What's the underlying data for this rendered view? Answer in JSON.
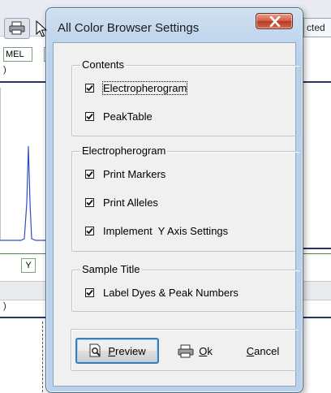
{
  "background": {
    "tab_text": "cted",
    "header_text": "MEL",
    "paren_text": ")",
    "y_label": "Y"
  },
  "dialog": {
    "title": "All Color Browser Settings",
    "groups": [
      {
        "label": "Contents",
        "items": [
          {
            "label": "Electropherogram",
            "checked": true
          },
          {
            "label": "PeakTable",
            "checked": true
          }
        ]
      },
      {
        "label": "Electropherogram",
        "items": [
          {
            "label": "Print Markers",
            "checked": true
          },
          {
            "label": "Print Alleles",
            "checked": true
          },
          {
            "label": "Implement  Y Axis Settings",
            "checked": true
          }
        ]
      },
      {
        "label": "Sample Title",
        "items": [
          {
            "label": "Label Dyes & Peak Numbers",
            "checked": true
          }
        ]
      }
    ],
    "buttons": {
      "preview": {
        "mnemonic": "P",
        "rest": "review"
      },
      "ok": {
        "mnemonic": "O",
        "rest": "k"
      },
      "cancel": {
        "mnemonic": "C",
        "rest": "ancel"
      }
    },
    "icons": {
      "close": "close-icon",
      "preview": "print-preview-icon",
      "ok": "printer-icon"
    }
  }
}
